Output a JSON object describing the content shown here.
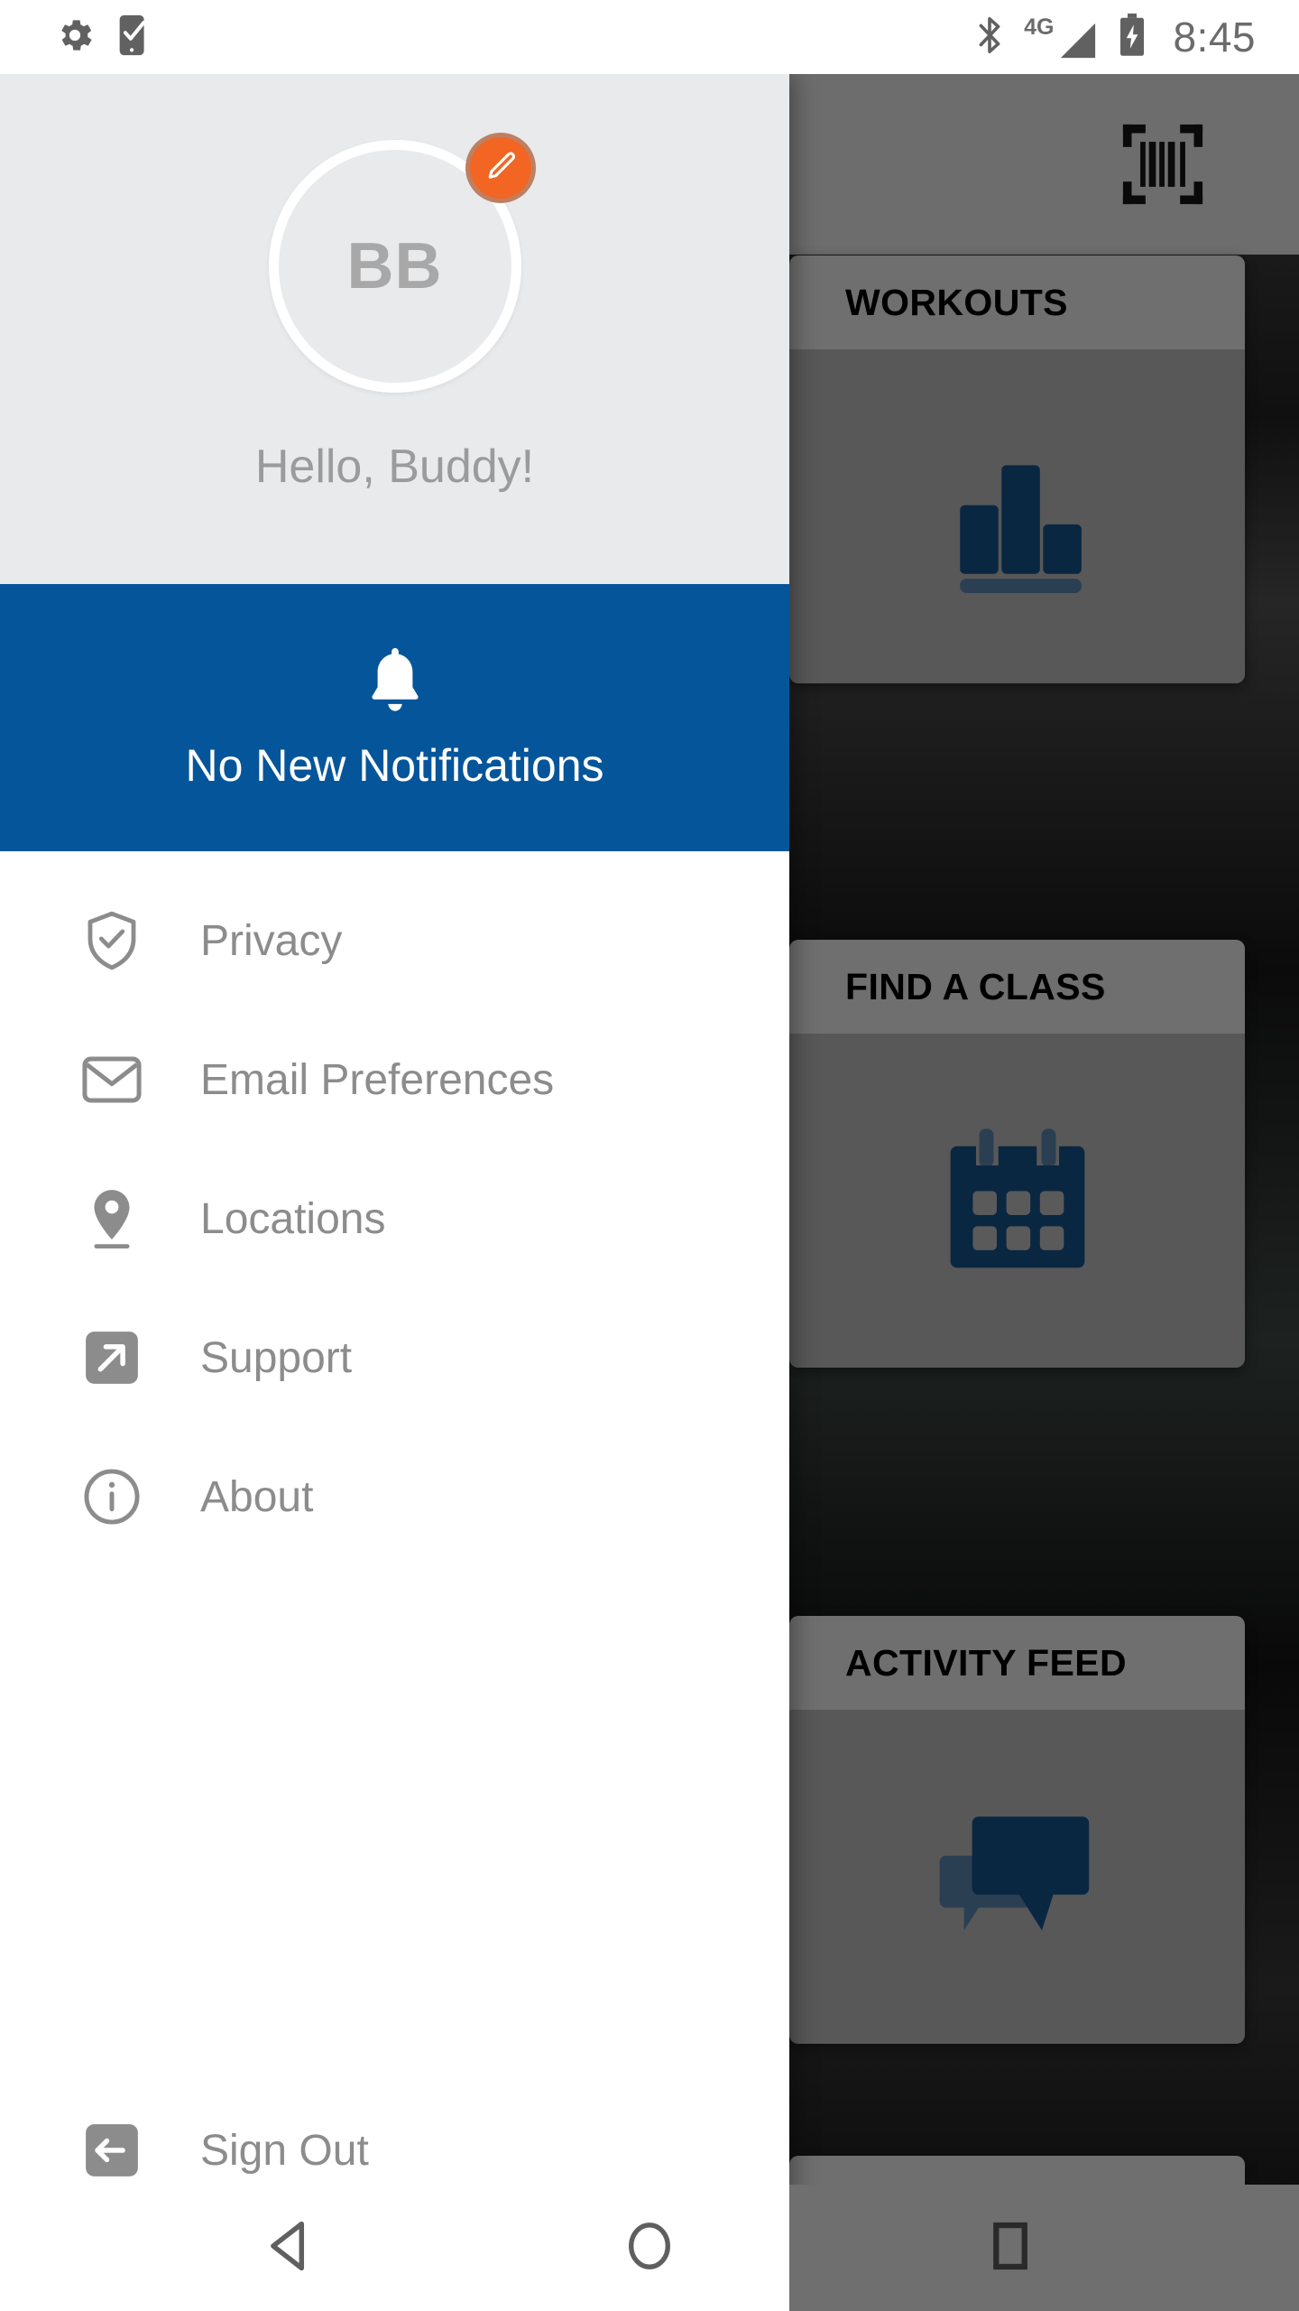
{
  "status_bar": {
    "left_icons": [
      "gear-icon",
      "phone-check-icon"
    ],
    "right_icons": [
      "bluetooth-icon",
      "signal-4g-icon",
      "battery-charging-icon"
    ],
    "network_label": "4G",
    "time": "8:45"
  },
  "drawer": {
    "profile": {
      "initials": "BB",
      "greeting": "Hello, Buddy!",
      "edit_badge_icon": "pencil-icon",
      "edit_badge_color": "#f26522",
      "background_color": "#e8eaec"
    },
    "notification": {
      "icon": "bell-icon",
      "text": "No New Notifications",
      "background_color": "#05559a"
    },
    "menu_items": [
      {
        "label": "Privacy",
        "icon": "shield-check-icon"
      },
      {
        "label": "Email Preferences",
        "icon": "envelope-icon"
      },
      {
        "label": "Locations",
        "icon": "map-pin-icon"
      },
      {
        "label": "Support",
        "icon": "external-link-icon"
      },
      {
        "label": "About",
        "icon": "info-circle-icon"
      }
    ],
    "sign_out": {
      "label": "Sign Out",
      "icon": "sign-out-icon"
    }
  },
  "app_background": {
    "top_bar": {
      "scan_icon": "barcode-scan-icon"
    },
    "cards": [
      {
        "title": "WORKOUTS",
        "icon": "bar-chart-icon"
      },
      {
        "title": "FIND A CLASS",
        "icon": "calendar-icon"
      },
      {
        "title": "ACTIVITY FEED",
        "icon": "chat-bubbles-icon"
      }
    ],
    "accent_color": "#0a2742"
  },
  "nav_bar": {
    "back_icon": "triangle-back-icon",
    "home_icon": "circle-home-icon",
    "recents_icon": "square-recents-icon"
  }
}
